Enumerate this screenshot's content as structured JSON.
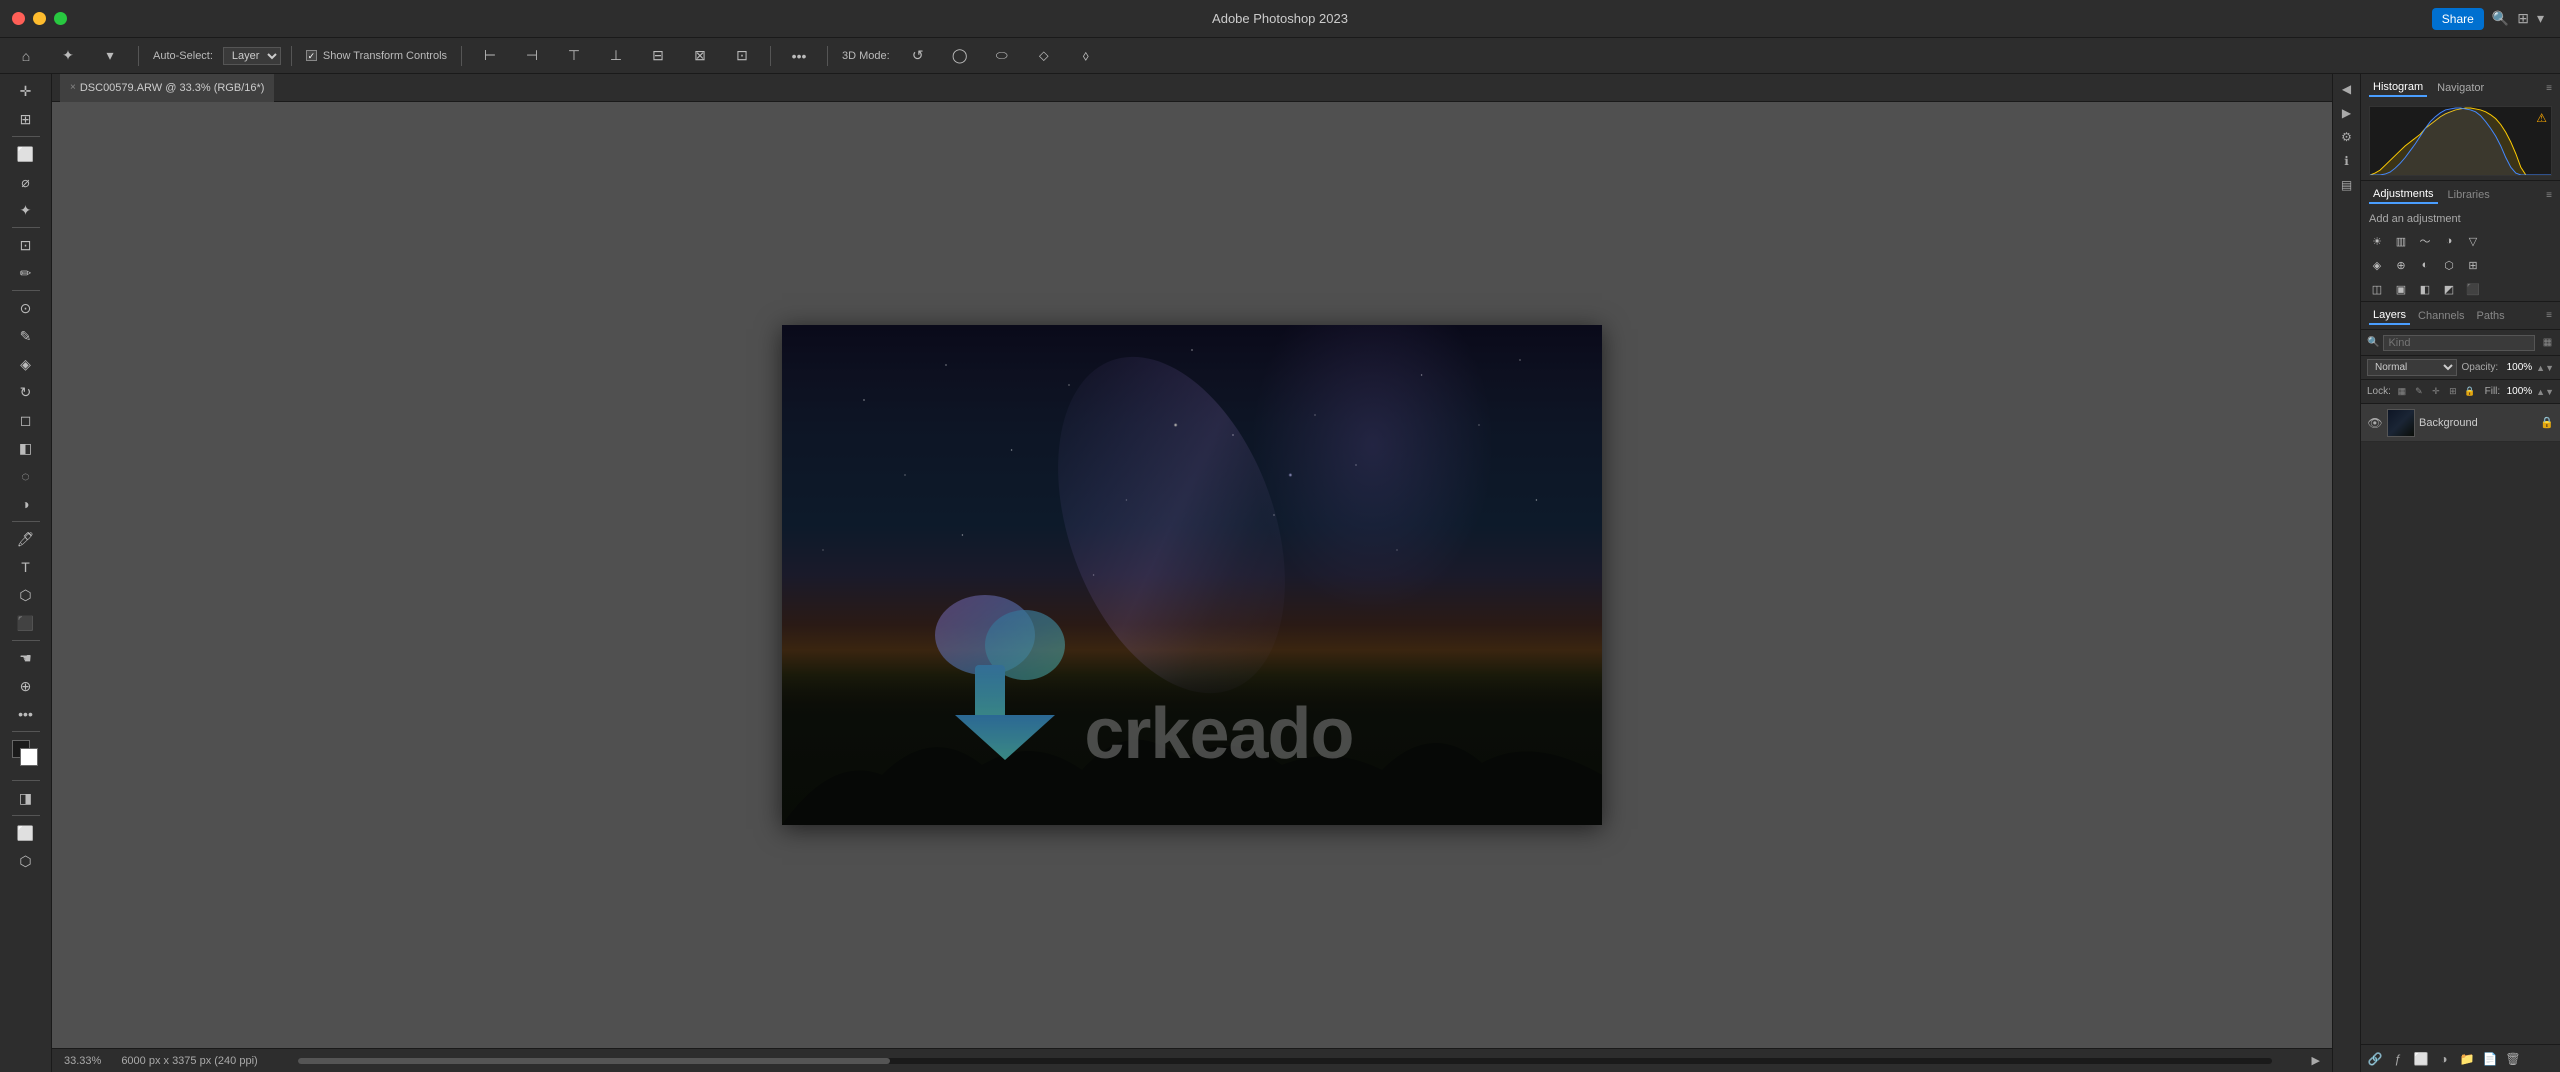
{
  "app": {
    "title": "Adobe Photoshop 2023",
    "share_label": "Share"
  },
  "tab": {
    "filename": "DSC00579.ARW @ 33.3% (RGB/16*)",
    "close_symbol": "×"
  },
  "toolbar": {
    "auto_select_label": "Auto-Select:",
    "layer_label": "Layer",
    "show_transform_label": "Show Transform Controls",
    "mode_3d_label": "3D Mode:"
  },
  "status": {
    "zoom": "33.33%",
    "dimensions": "6000 px x 3375 px (240 ppi)"
  },
  "histogram": {
    "tab_label": "Histogram",
    "navigator_label": "Navigator"
  },
  "adjustments": {
    "tab_label": "Adjustments",
    "libraries_label": "Libraries",
    "add_adjustment_label": "Add an adjustment"
  },
  "layers_panel": {
    "layers_label": "Layers",
    "channels_label": "Channels",
    "paths_label": "Paths",
    "search_placeholder": "Kind",
    "blend_mode": "Normal",
    "opacity_label": "Opacity:",
    "opacity_value": "100%",
    "lock_label": "Lock:",
    "fill_label": "Fill:",
    "fill_value": "100%"
  },
  "layers": [
    {
      "name": "Background",
      "visible": true,
      "locked": true
    }
  ],
  "watermark": {
    "text": "crkeado"
  },
  "bottom_icons": {
    "link": "🔗",
    "fx": "ƒx",
    "mask": "⬜",
    "adjustment": "◑",
    "group": "📁",
    "new": "📄",
    "delete": "🗑"
  }
}
